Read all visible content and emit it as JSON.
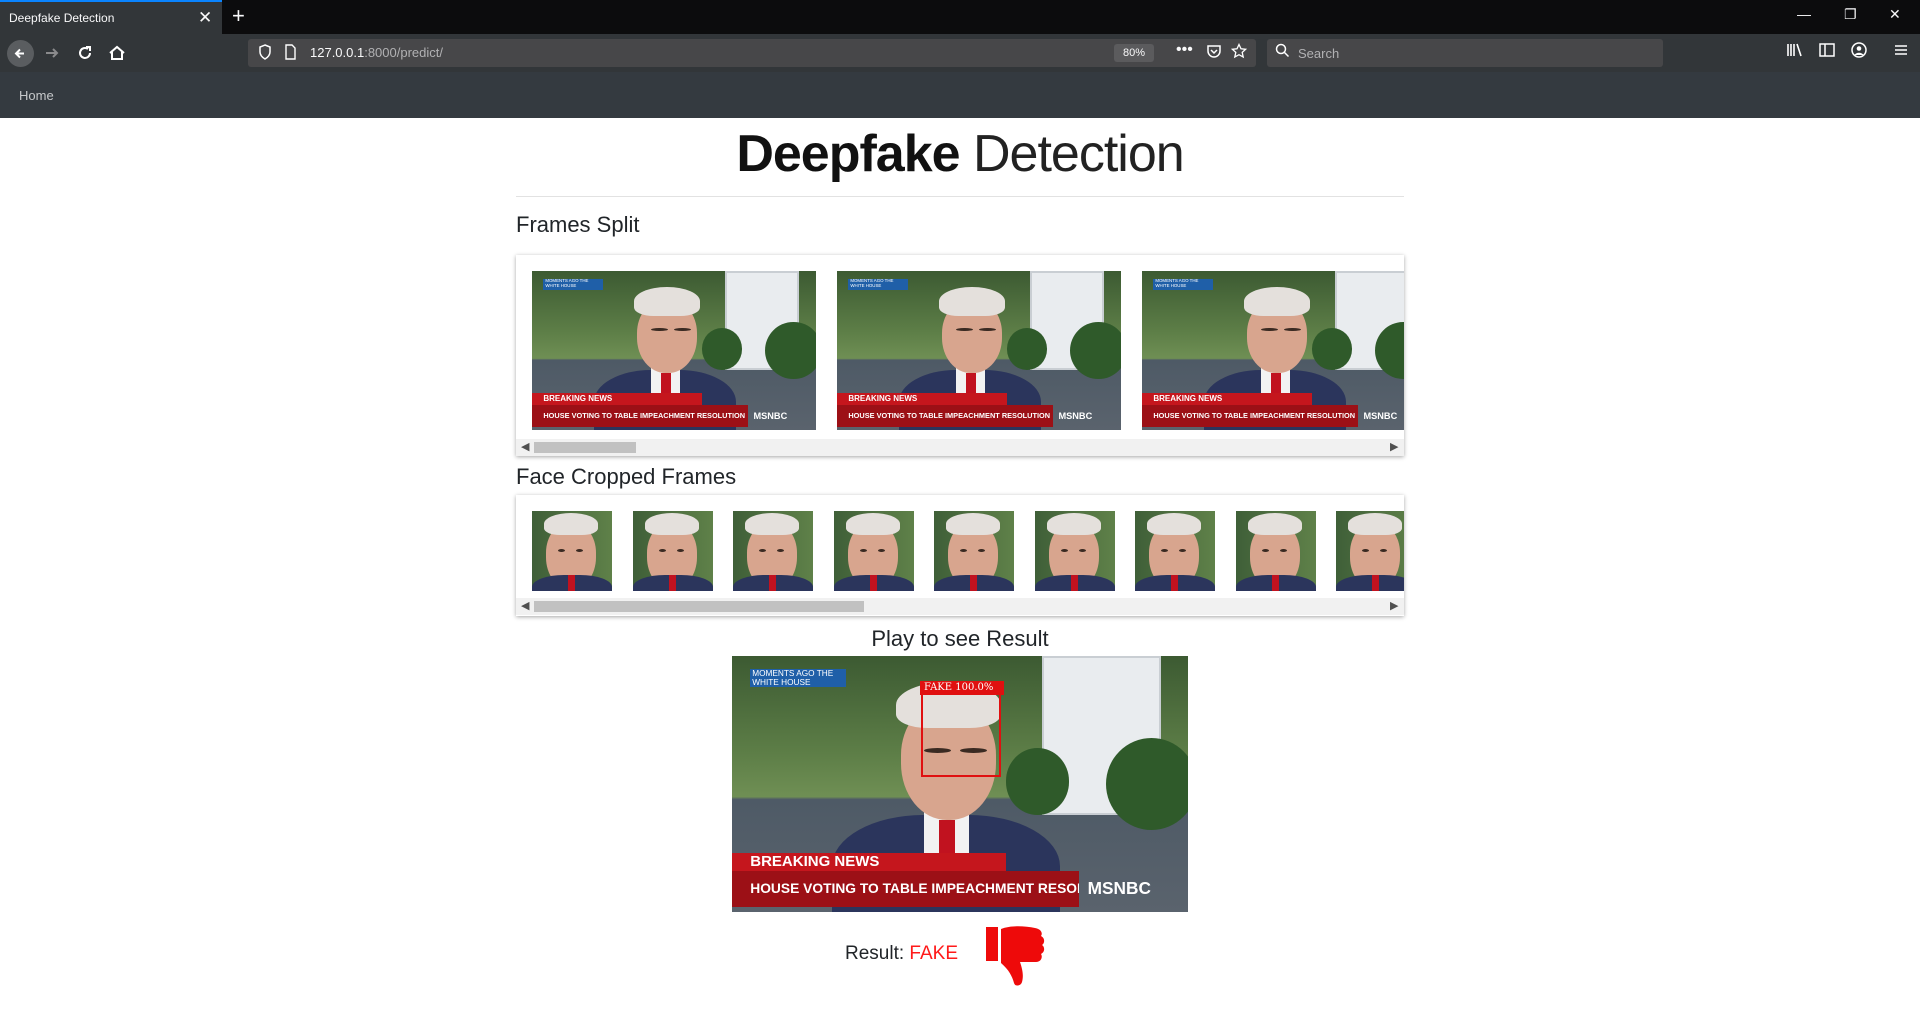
{
  "browser": {
    "tab_title": "Deepfake Detection",
    "tab_close": "✕",
    "new_tab": "+",
    "url_host": "127.0.0.1",
    "url_path": ":8000/predict/",
    "zoom": "80%",
    "search_placeholder": "Search",
    "window_controls": {
      "minimize": "—",
      "restore": "❐",
      "close": "✕"
    }
  },
  "site_nav": {
    "home": "Home"
  },
  "page": {
    "brand_bold": "Deepfake",
    "brand_light": "Detection",
    "frames_split_title": "Frames Split",
    "face_cropped_title": "Face Cropped Frames",
    "play_title": "Play to see Result",
    "result_label": "Result:",
    "result_value": "FAKE"
  },
  "news_overlay": {
    "corner_tag_line1": "MOMENTS AGO",
    "corner_tag_line2": "THE WHITE HOUSE",
    "breaking": "BREAKING NEWS",
    "headline": "HOUSE VOTING TO TABLE IMPEACHMENT RESOLUTION",
    "network": "MSNBC"
  },
  "detection": {
    "label": "FAKE 100.0%"
  },
  "frames_split": {
    "count_visible": 3,
    "scroll_position_fraction": 0.0
  },
  "face_cropped": {
    "count_visible": 9,
    "scroll_position_fraction": 0.0
  },
  "colors": {
    "accent_red": "#ff1a1a",
    "nav_dark": "#343a40",
    "tab_accent": "#0a84ff"
  }
}
